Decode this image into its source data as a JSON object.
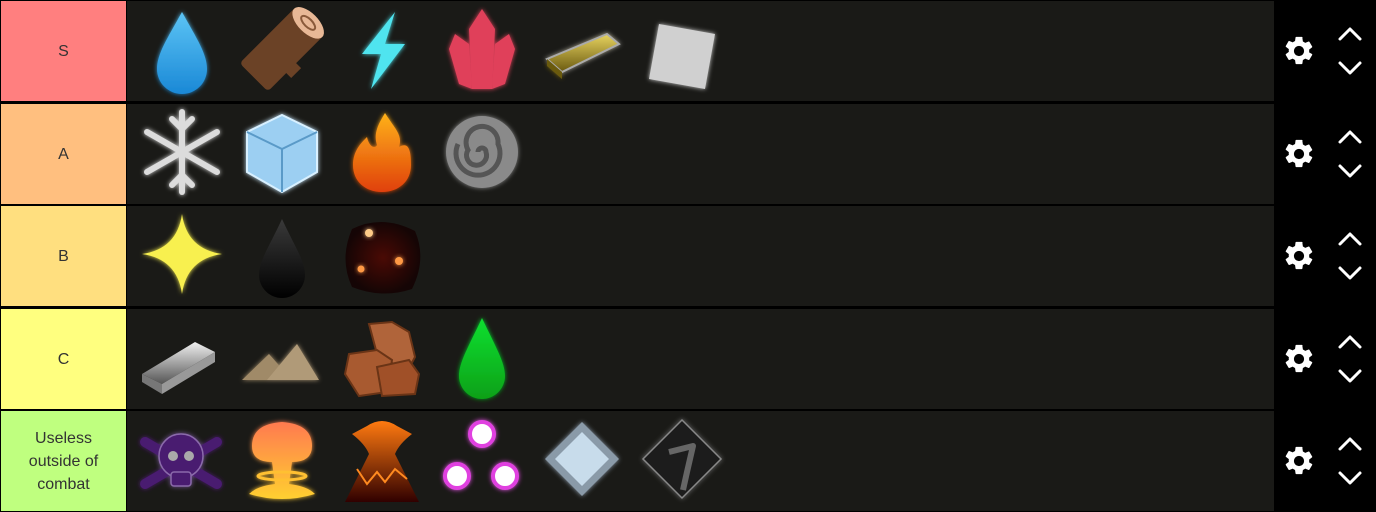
{
  "tiers": [
    {
      "label": "S",
      "color": "#ff7f7f",
      "items": [
        "water-drop-icon",
        "log-icon",
        "lightning-icon",
        "crystal-icon",
        "gold-bar-icon",
        "paper-icon"
      ]
    },
    {
      "label": "A",
      "color": "#ffbf7f",
      "items": [
        "snowflake-icon",
        "ice-cube-icon",
        "fire-icon",
        "spiral-icon"
      ]
    },
    {
      "label": "B",
      "color": "#ffdf7f",
      "items": [
        "light-sparkle-icon",
        "dark-drop-icon",
        "magma-ember-icon"
      ]
    },
    {
      "label": "C",
      "color": "#ffff7f",
      "items": [
        "iron-bar-icon",
        "sand-dunes-icon",
        "rock-icon",
        "green-drop-icon"
      ]
    },
    {
      "label": "Useless outside of combat",
      "color": "#bfff7f",
      "items": [
        "poison-skull-icon",
        "explosion-icon",
        "volcano-icon",
        "orbs-icon",
        "glass-diamond-icon",
        "shadow-tile-icon"
      ]
    }
  ],
  "controls": {
    "settings_icon": "gear-icon",
    "up_icon": "chevron-up-icon",
    "down_icon": "chevron-down-icon"
  }
}
